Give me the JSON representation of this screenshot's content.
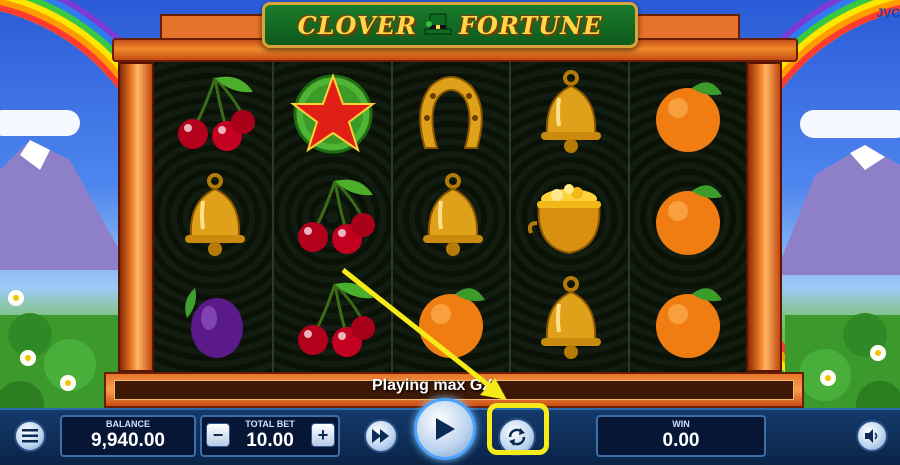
{
  "game": {
    "title_left": "CLOVER",
    "title_right": "FORTUNE",
    "provider_badge": "JVC"
  },
  "reels": [
    [
      "cherries",
      "bell",
      "plum"
    ],
    [
      "star",
      "cherries",
      "cherries"
    ],
    [
      "horseshoe",
      "bell",
      "orange"
    ],
    [
      "bell",
      "pot-of-gold",
      "bell"
    ],
    [
      "orange",
      "orange",
      "orange"
    ]
  ],
  "status_message": "Playing max GX",
  "bottom_bar": {
    "balance_label": "BALANCE",
    "balance_value": "9,940.00",
    "total_bet_label": "TOTAL BET",
    "total_bet_value": "10.00",
    "win_label": "WIN",
    "win_value": "0.00",
    "minus_label": "−",
    "plus_label": "+"
  },
  "icons": {
    "menu": "menu-icon",
    "fast_forward": "fast-forward-icon",
    "spin": "play-icon",
    "autoplay": "autoplay-icon",
    "sound": "sound-icon"
  },
  "colors": {
    "highlight": "#f6ea18",
    "frame": "#f08a2a",
    "bar": "#143a6b"
  }
}
